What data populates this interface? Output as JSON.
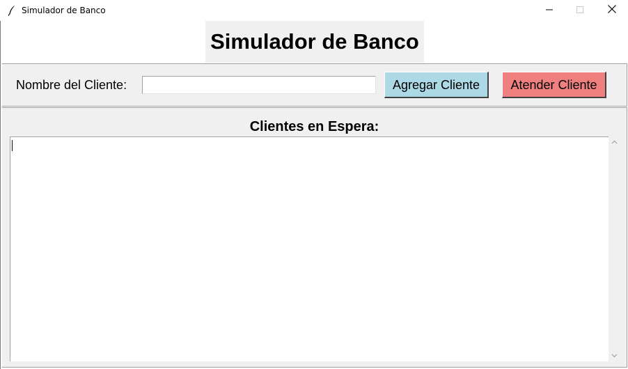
{
  "window": {
    "title": "Simulador de Banco",
    "icon": "feather-icon",
    "controls": [
      "minimize-icon",
      "maximize-icon",
      "close-icon"
    ]
  },
  "header": {
    "title": "Simulador de Banco"
  },
  "form": {
    "name_label": "Nombre del Cliente:",
    "name_value": "",
    "add_button": "Agregar Cliente",
    "serve_button": "Atender Cliente"
  },
  "queue": {
    "title": "Clientes en Espera:",
    "content": ""
  },
  "colors": {
    "add_button_bg": "#add8e6",
    "serve_button_bg": "#f08080",
    "panel_bg": "#f0f0f0"
  }
}
